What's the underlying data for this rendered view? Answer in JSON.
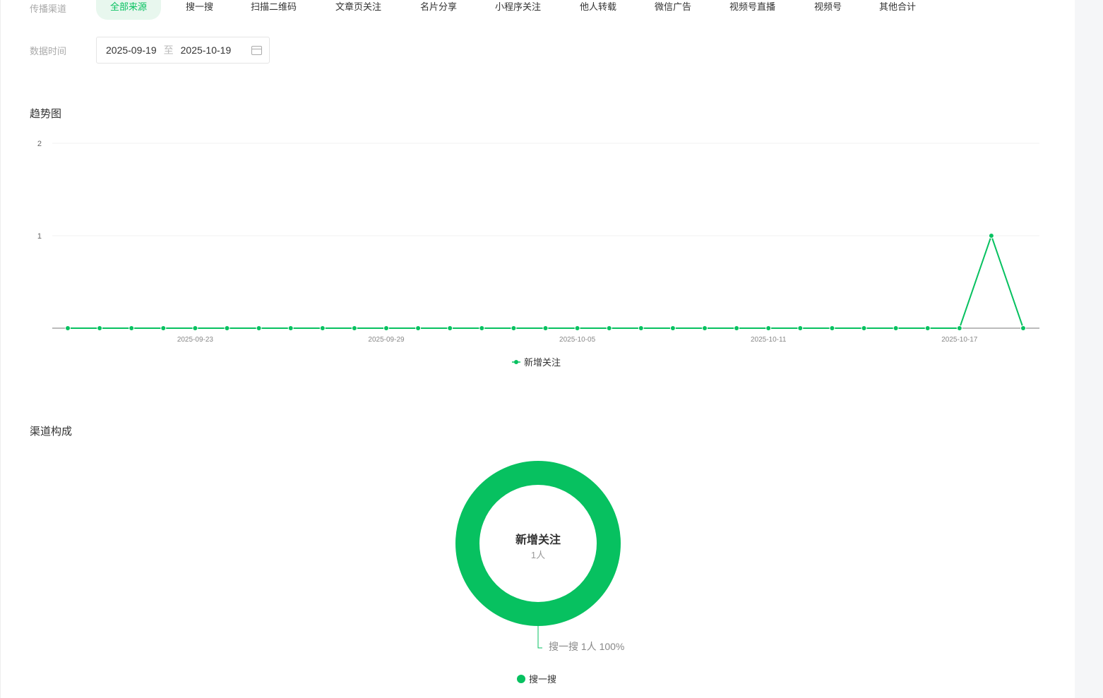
{
  "filter": {
    "channel_label": "传播渠道",
    "tabs": [
      "全部来源",
      "搜一搜",
      "扫描二维码",
      "文章页关注",
      "名片分享",
      "小程序关注",
      "他人转载",
      "微信广告",
      "视频号直播",
      "视频号",
      "其他合计"
    ],
    "active_tab": 0,
    "date_label": "数据时间",
    "date_start": "2025-09-19",
    "date_sep": "至",
    "date_end": "2025-10-19"
  },
  "trend": {
    "title": "趋势图"
  },
  "composition": {
    "title": "渠道构成",
    "center_title": "新增关注",
    "center_value": "1人",
    "slice_label": "搜一搜 1人 100%",
    "legend": "搜一搜"
  },
  "colors": {
    "accent": "#07c160"
  },
  "chart_data": [
    {
      "type": "line",
      "title": "趋势图",
      "ylim": [
        0,
        2
      ],
      "yticks": [
        "1",
        "2"
      ],
      "x": [
        "2025-09-19",
        "2025-09-20",
        "2025-09-21",
        "2025-09-22",
        "2025-09-23",
        "2025-09-24",
        "2025-09-25",
        "2025-09-26",
        "2025-09-27",
        "2025-09-28",
        "2025-09-29",
        "2025-09-30",
        "2025-10-01",
        "2025-10-02",
        "2025-10-03",
        "2025-10-04",
        "2025-10-05",
        "2025-10-06",
        "2025-10-07",
        "2025-10-08",
        "2025-10-09",
        "2025-10-10",
        "2025-10-11",
        "2025-10-12",
        "2025-10-13",
        "2025-10-14",
        "2025-10-15",
        "2025-10-16",
        "2025-10-17",
        "2025-10-18",
        "2025-10-19"
      ],
      "xtick_labels": [
        "2025-09-23",
        "2025-09-29",
        "2025-10-05",
        "2025-10-11",
        "2025-10-17"
      ],
      "series": [
        {
          "name": "新增关注",
          "values": [
            0,
            0,
            0,
            0,
            0,
            0,
            0,
            0,
            0,
            0,
            0,
            0,
            0,
            0,
            0,
            0,
            0,
            0,
            0,
            0,
            0,
            0,
            0,
            0,
            0,
            0,
            0,
            0,
            0,
            1,
            0
          ]
        }
      ],
      "legend": "bottom"
    },
    {
      "type": "pie",
      "title": "渠道构成",
      "slices": [
        {
          "name": "搜一搜",
          "value": 1,
          "percent": 100
        }
      ]
    }
  ]
}
